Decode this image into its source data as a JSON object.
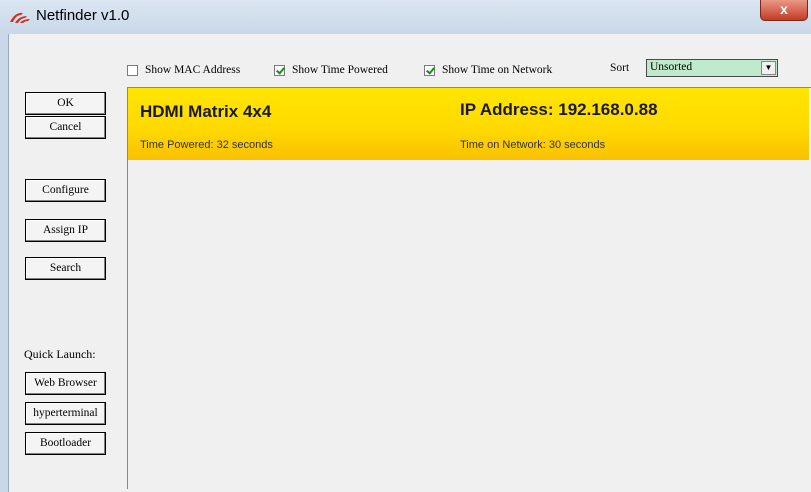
{
  "window": {
    "title": "Netfinder v1.0",
    "close_label": "x"
  },
  "options": {
    "show_mac": {
      "label": "Show MAC Address",
      "checked": false
    },
    "show_time_powered": {
      "label": "Show Time Powered",
      "checked": true
    },
    "show_time_on_network": {
      "label": "Show Time on Network",
      "checked": true
    }
  },
  "sort": {
    "label": "Sort",
    "value": "Unsorted"
  },
  "buttons": {
    "ok": "OK",
    "cancel": "Cancel",
    "configure": "Configure",
    "assign_ip": "Assign IP",
    "search": "Search"
  },
  "quick_launch": {
    "label": "Quick Launch:",
    "web_browser": "Web Browser",
    "hyperterminal": "hyperterminal",
    "bootloader": "Bootloader"
  },
  "device": {
    "name": "HDMI Matrix 4x4",
    "ip": "IP Address: 192.168.0.88",
    "time_powered": "Time Powered:  32 seconds",
    "time_on_network": "Time on Network:  30 seconds"
  },
  "colors": {
    "highlight": "#ffda00",
    "title_bar": "#c9d7e8",
    "close": "#c43c25",
    "select_bg": "#bfeacb"
  }
}
